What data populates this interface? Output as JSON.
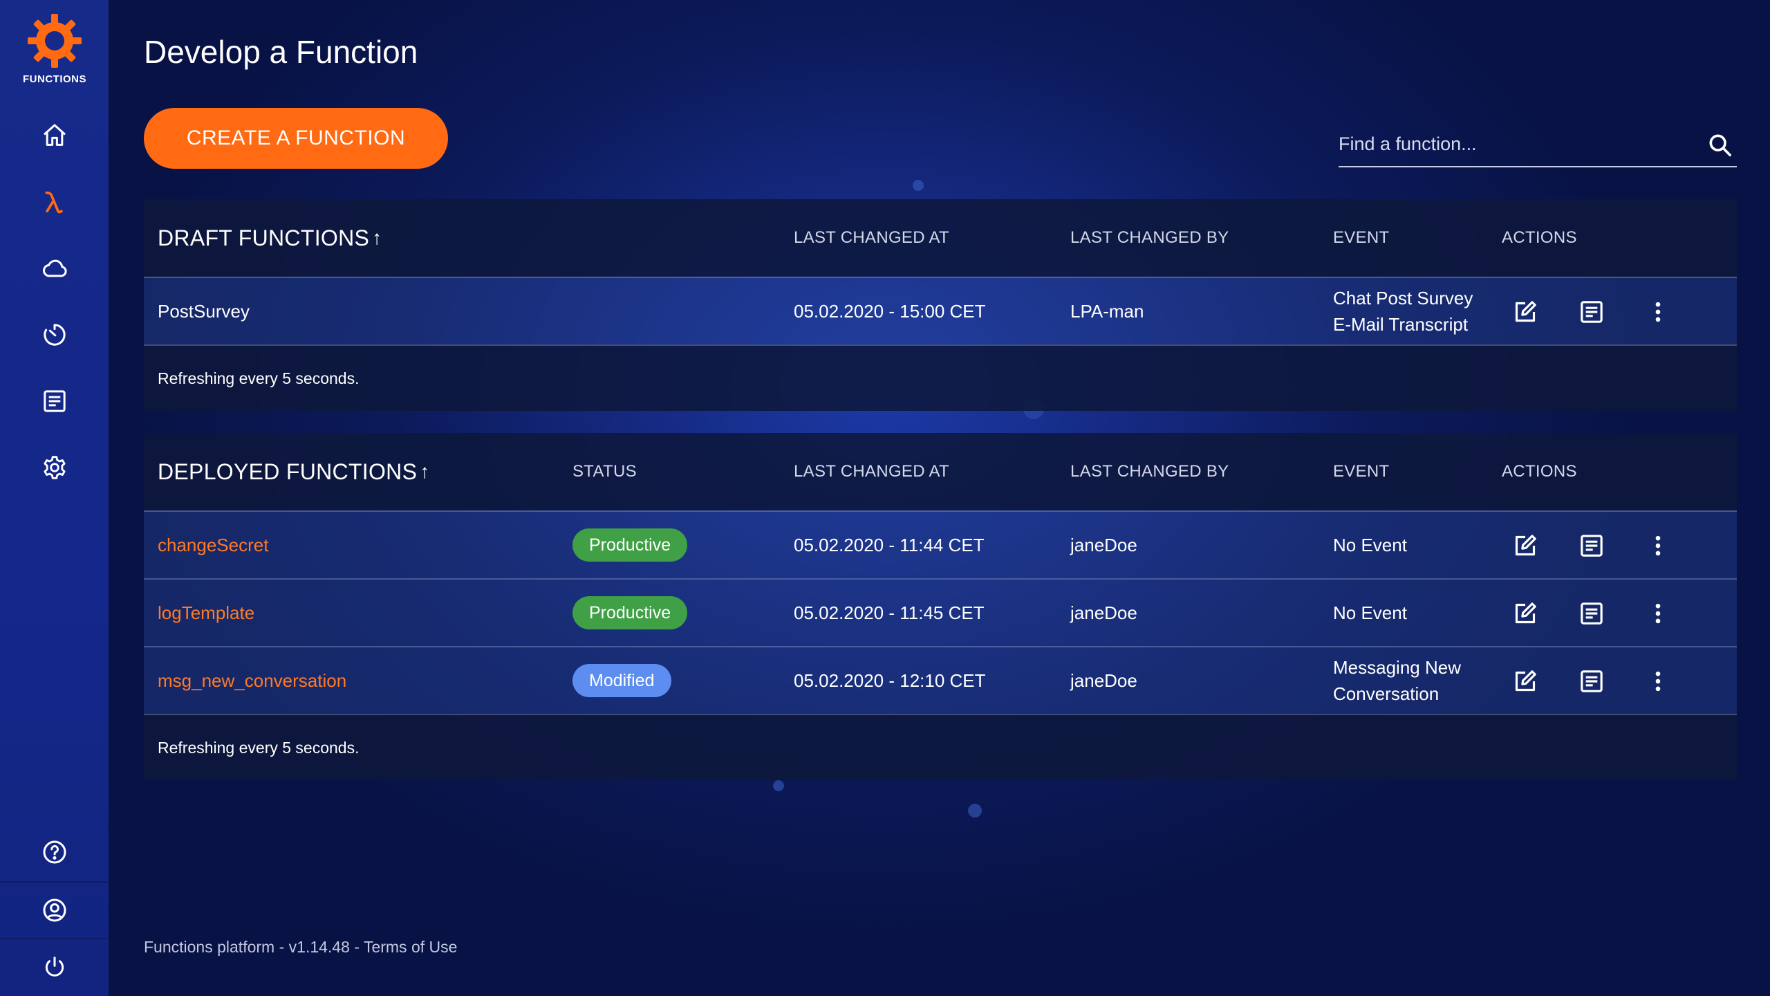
{
  "app": {
    "logo_label": "FUNCTIONS",
    "accent_color": "#ff6a13"
  },
  "sidebar": {
    "items": [
      {
        "name": "home",
        "icon": "home-icon"
      },
      {
        "name": "functions",
        "icon": "lambda-icon",
        "active": true
      },
      {
        "name": "cloud",
        "icon": "cloud-icon"
      },
      {
        "name": "schedule",
        "icon": "timer-icon"
      },
      {
        "name": "logs",
        "icon": "document-icon"
      },
      {
        "name": "settings",
        "icon": "gear-icon"
      }
    ],
    "bottom_items": [
      {
        "name": "help",
        "icon": "help-icon"
      },
      {
        "name": "account",
        "icon": "user-icon"
      },
      {
        "name": "logout",
        "icon": "power-icon"
      }
    ]
  },
  "page": {
    "title": "Develop a Function"
  },
  "toolbar": {
    "create_label": "CREATE A FUNCTION"
  },
  "search": {
    "placeholder": "Find a function..."
  },
  "draft": {
    "title": "DRAFT FUNCTIONS",
    "sort_arrow": "↑",
    "columns": {
      "changed_at": "LAST CHANGED AT",
      "changed_by": "LAST CHANGED BY",
      "event": "EVENT",
      "actions": "ACTIONS"
    },
    "rows": [
      {
        "name": "PostSurvey",
        "changed_at": "05.02.2020 - 15:00 CET",
        "changed_by": "LPA-man",
        "event_line1": "Chat Post Survey",
        "event_line2": "E-Mail Transcript"
      }
    ],
    "footer": "Refreshing every 5 seconds."
  },
  "deployed": {
    "title": "DEPLOYED FUNCTIONS",
    "sort_arrow": "↑",
    "columns": {
      "status": "STATUS",
      "changed_at": "LAST CHANGED AT",
      "changed_by": "LAST CHANGED BY",
      "event": "EVENT",
      "actions": "ACTIONS"
    },
    "rows": [
      {
        "name": "changeSecret",
        "status": "Productive",
        "status_color": "#3fa046",
        "changed_at": "05.02.2020 - 11:44 CET",
        "changed_by": "janeDoe",
        "event_line1": "No Event",
        "event_line2": ""
      },
      {
        "name": "logTemplate",
        "status": "Productive",
        "status_color": "#3fa046",
        "changed_at": "05.02.2020 - 11:45 CET",
        "changed_by": "janeDoe",
        "event_line1": "No Event",
        "event_line2": ""
      },
      {
        "name": "msg_new_conversation",
        "status": "Modified",
        "status_color": "#5d8df0",
        "changed_at": "05.02.2020 - 12:10 CET",
        "changed_by": "janeDoe",
        "event_line1": "Messaging New",
        "event_line2": "Conversation"
      }
    ],
    "footer": "Refreshing every 5 seconds."
  },
  "footer": {
    "platform": "Functions platform",
    "version": "v1.14.48",
    "separator": " - ",
    "terms": "Terms of Use"
  }
}
